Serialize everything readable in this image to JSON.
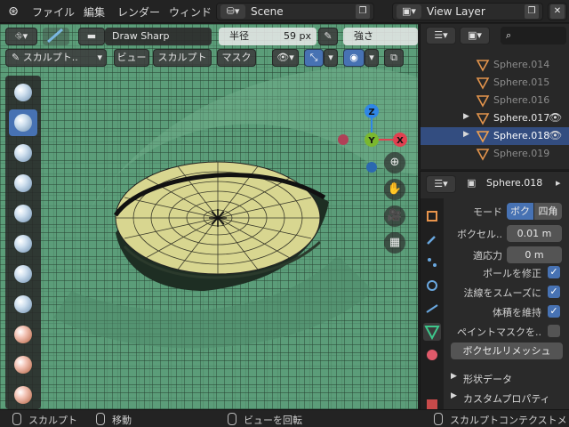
{
  "topbar": {
    "menus": [
      "ファイル",
      "編集",
      "レンダー",
      "ウィンド"
    ],
    "scene": "Scene",
    "view_layer": "View Layer"
  },
  "viewport": {
    "brush_name": "Draw Sharp",
    "radius_label": "半径",
    "radius_value": "59 px",
    "strength_label": "強さ",
    "mode_label": "スカルプト..",
    "header_menus": [
      "ビュー",
      "スカルプト",
      "マスク"
    ],
    "gizmo": {
      "z": "Z",
      "y": "Y",
      "x": "X"
    }
  },
  "outliner": {
    "items": [
      {
        "name": "Sphere.014",
        "selected": false,
        "visible": false
      },
      {
        "name": "Sphere.015",
        "selected": false,
        "visible": false
      },
      {
        "name": "Sphere.016",
        "selected": false,
        "visible": false
      },
      {
        "name": "Sphere.017",
        "selected": false,
        "visible": true
      },
      {
        "name": "Sphere.018",
        "selected": true,
        "visible": true
      },
      {
        "name": "Sphere.019",
        "selected": false,
        "visible": false
      }
    ]
  },
  "properties": {
    "object_name": "Sphere.018",
    "mode_label": "モード",
    "mode_options": [
      "ボク",
      "四角"
    ],
    "voxel_size_label": "ボクセル..",
    "voxel_size_value": "0.01 m",
    "adaptivity_label": "適応力",
    "adaptivity_value": "0 m",
    "fix_poles_label": "ポールを修正",
    "smooth_normals_label": "法線をスムーズに",
    "preserve_volume_label": "体積を維持",
    "paint_mask_label": "ペイントマスクを..",
    "voxel_remesh_button": "ボクセルリメッシュ",
    "section_shape_data": "形状データ",
    "section_custom_props": "カスタムプロパティ"
  },
  "statusbar": {
    "sculpt": "スカルプト",
    "move": "移動",
    "rotate_view": "ビューを回転",
    "context": "スカルプトコンテクストメ"
  },
  "colors": {
    "mesh_green": "#5b9d79",
    "eye_fill": "#d8d690",
    "accent_blue": "#4772b3",
    "selected_row": "#334d80",
    "gizmo_x": "#e04050",
    "gizmo_y": "#7ab82e",
    "gizmo_z": "#2f86e6"
  }
}
